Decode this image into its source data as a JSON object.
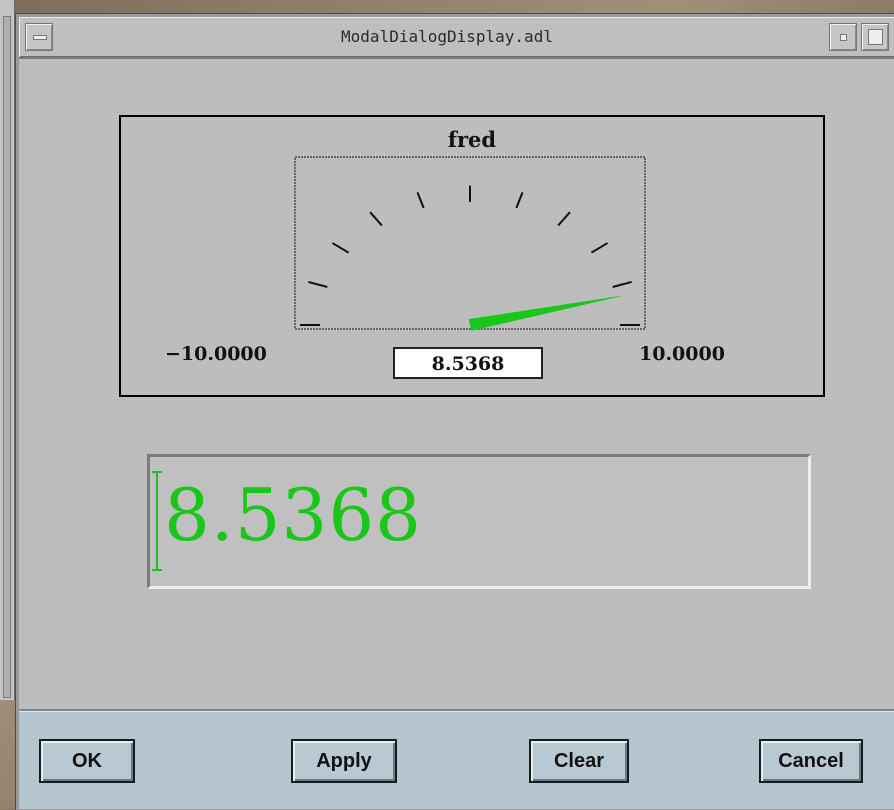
{
  "window": {
    "title": "ModalDialogDisplay.adl"
  },
  "meter": {
    "label": "fred",
    "min_label": "−10.0000",
    "max_label": "10.0000",
    "value_label": "8.5368",
    "min": -10.0,
    "max": 10.0,
    "value": 8.5368,
    "needle_color": "#19c619"
  },
  "text_entry": {
    "value": "8.5368",
    "color": "#19c619"
  },
  "buttons": {
    "ok": "OK",
    "apply": "Apply",
    "clear": "Clear",
    "cancel": "Cancel"
  },
  "icons": {
    "window_menu": "window-menu-icon",
    "minimize": "minimize-icon",
    "maximize": "maximize-icon"
  }
}
